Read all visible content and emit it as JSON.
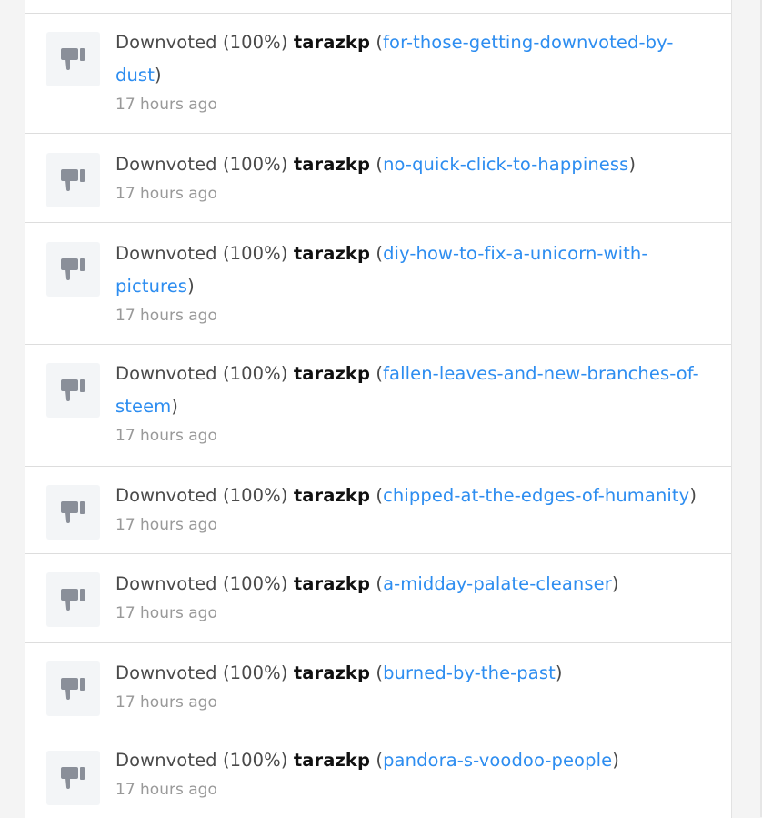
{
  "activity": {
    "action_text": "Downvoted (100%)",
    "items": [
      {
        "author": "tarazkp",
        "permlink": "for-those-getting-downvoted-by-dust",
        "time": "17 hours ago"
      },
      {
        "author": "tarazkp",
        "permlink": "no-quick-click-to-happiness",
        "time": "17 hours ago"
      },
      {
        "author": "tarazkp",
        "permlink": "diy-how-to-fix-a-unicorn-with-pictures",
        "time": "17 hours ago"
      },
      {
        "author": "tarazkp",
        "permlink": "fallen-leaves-and-new-branches-of-steem",
        "time": "17 hours ago"
      },
      {
        "author": "tarazkp",
        "permlink": "chipped-at-the-edges-of-humanity",
        "time": "17 hours ago"
      },
      {
        "author": "tarazkp",
        "permlink": "a-midday-palate-cleanser",
        "time": "17 hours ago"
      },
      {
        "author": "tarazkp",
        "permlink": "burned-by-the-past",
        "time": "17 hours ago"
      },
      {
        "author": "tarazkp",
        "permlink": "pandora-s-voodoo-people",
        "time": "17 hours ago"
      }
    ]
  },
  "icon": {
    "name": "thumbs-down-icon",
    "color": "#8a8f99",
    "background": "#f3f5f7"
  },
  "colors": {
    "link": "#2d8df0",
    "text": "#4a4a4a",
    "muted": "#999999",
    "author": "#111111"
  }
}
